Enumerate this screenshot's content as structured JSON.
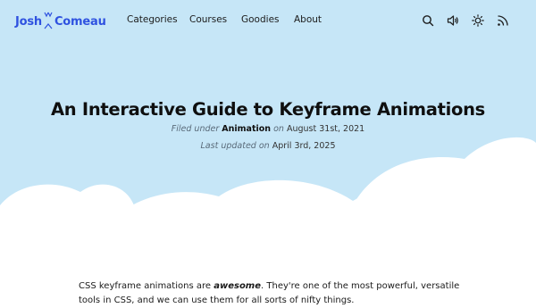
{
  "header": {
    "logo_first": "Josh",
    "logo_last": "Comeau",
    "nav": [
      "Categories",
      "Courses",
      "Goodies",
      "About"
    ],
    "icons": [
      "search-icon",
      "sound-icon",
      "theme-sun-icon",
      "rss-icon"
    ]
  },
  "article": {
    "title": "An Interactive Guide to Keyframe Animations",
    "filed_prefix": "Filed under",
    "category": "Animation",
    "on": "on",
    "date": "August 31st, 2021",
    "updated_prefix": "Last updated on",
    "updated_date": "April 3rd, 2025"
  },
  "intro": {
    "part1": "CSS keyframe animations are",
    "emphasis": "awesome",
    "part2": ". They're one of the most powerful, versatile tools in CSS, and we can use them for all sorts of nifty things."
  },
  "colors": {
    "sky": "#c6e6f7",
    "accent": "#2f52e0",
    "cloud": "#ffffff"
  }
}
